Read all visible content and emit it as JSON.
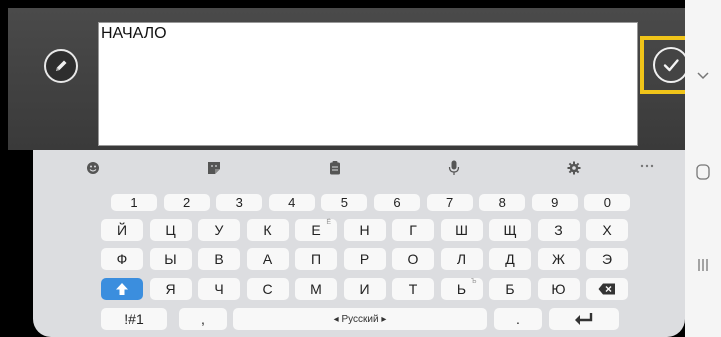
{
  "editor": {
    "text": "НАЧАЛО"
  },
  "keyboard": {
    "number_row": [
      "1",
      "2",
      "3",
      "4",
      "5",
      "6",
      "7",
      "8",
      "9",
      "0"
    ],
    "row1": [
      "Й",
      "Ц",
      "У",
      "К",
      "Е",
      "Н",
      "Г",
      "Ш",
      "Щ",
      "З",
      "Х"
    ],
    "row1_hint": "Ё",
    "row2": [
      "Ф",
      "Ы",
      "В",
      "А",
      "П",
      "Р",
      "О",
      "Л",
      "Д",
      "Ж",
      "Э"
    ],
    "row3": [
      "Я",
      "Ч",
      "С",
      "М",
      "И",
      "Т",
      "Ь",
      "Б",
      "Ю"
    ],
    "row3_hint": "Ъ",
    "symbols_label": "!#1",
    "comma_label": ",",
    "space_label": "◂ Русский ▸",
    "period_label": "."
  },
  "colors": {
    "highlight": "#f0c419",
    "shift_key": "#3b8ede"
  }
}
